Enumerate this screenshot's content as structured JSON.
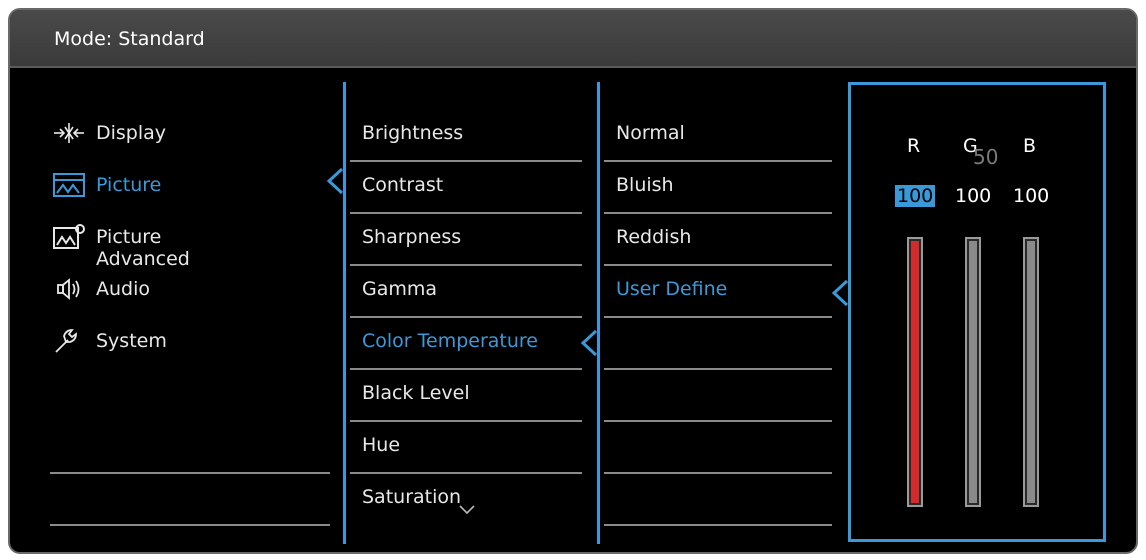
{
  "title": "Mode: Standard",
  "menu": [
    {
      "label": "Display",
      "icon": "display-icon"
    },
    {
      "label": "Picture",
      "icon": "picture-icon",
      "selected": true
    },
    {
      "label": "Picture Advanced",
      "icon": "picture-advanced-icon"
    },
    {
      "label": "Audio",
      "icon": "audio-icon"
    },
    {
      "label": "System",
      "icon": "system-icon"
    }
  ],
  "picture_items": [
    "Brightness",
    "Contrast",
    "Sharpness",
    "Gamma",
    "Color Temperature",
    "Black Level",
    "Hue",
    "Saturation"
  ],
  "color_temp_options": [
    "Normal",
    "Bluish",
    "Reddish",
    "User Define"
  ],
  "rgb": {
    "channels": [
      "R",
      "G",
      "B"
    ],
    "values": [
      "100",
      "100",
      "100"
    ],
    "ghost_value": "50",
    "levels": [
      1.0,
      1.0,
      1.0
    ],
    "colors": [
      "#d42a2a",
      "#8a8a8a",
      "#8a8a8a"
    ]
  },
  "colors": {
    "accent": "#3a9ad9"
  }
}
